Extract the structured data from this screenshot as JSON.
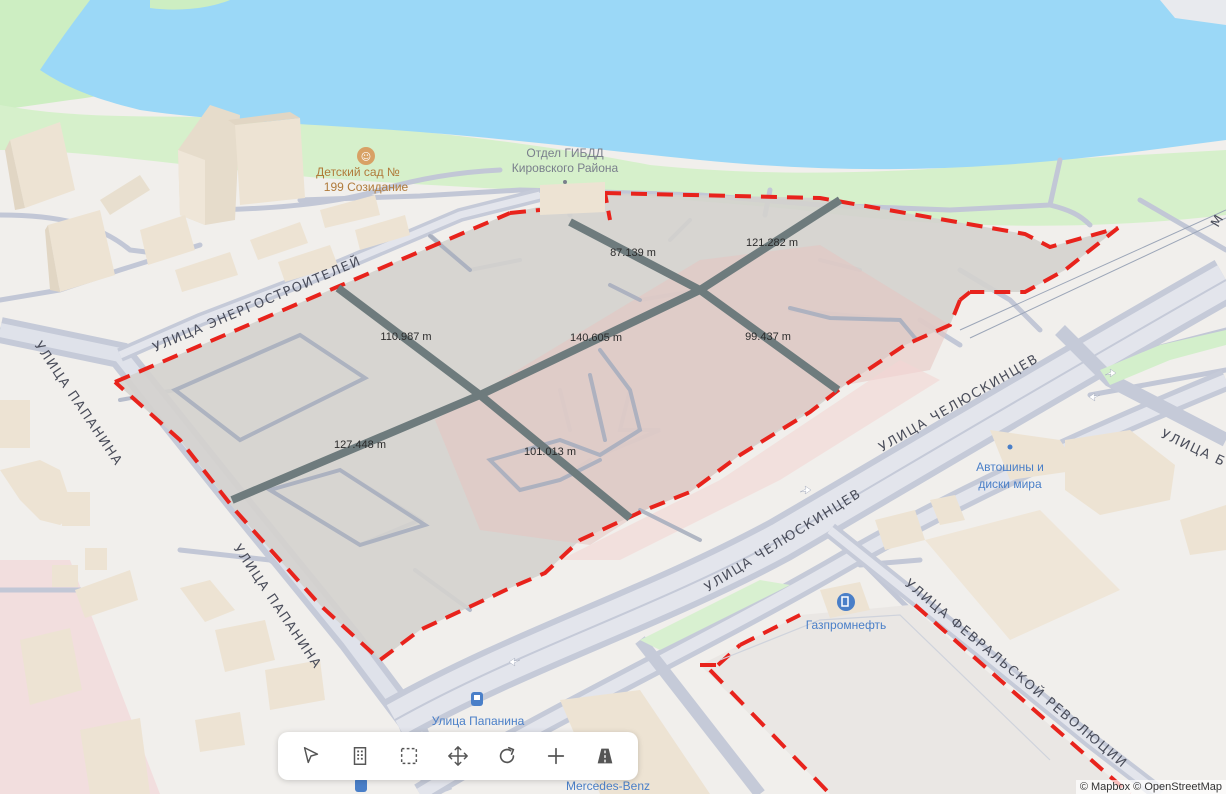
{
  "labels": {
    "streets": {
      "energostroiteley": "УЛИЦА ЭНЕРГОСТРОИТЕЛЕЙ",
      "papanina_upper": "УЛИЦА ПАПАНИНА",
      "papanina_lower": "УЛИЦА ПАПАНИНА",
      "chelyuskintsev_upper": "УЛИЦА ЧЕЛЮСКИНЦЕВ",
      "chelyuskintsev_lower": "УЛИЦА ЧЕЛЮСКИНЦЕВ",
      "fevralskoy": "УЛИЦА ФЕВРАЛЬСКОЙ РЕВОЛЮЦИИ",
      "edge_right": "УЛИЦА Б",
      "edge_topright": "М"
    },
    "pois": {
      "kindergarten_line1": "Детский сад №",
      "kindergarten_line2": "199 Созидание",
      "gibdd_line1": "Отдел ГИБДД",
      "gibdd_line2": "Кировского Района",
      "autoshiny_line1": "Автошины и",
      "autoshiny_line2": "диски мира",
      "gazprom": "Газпромнефть",
      "papanina_stop": "Улица Папанина",
      "mercedes": "Mercedes-Benz"
    },
    "measurements": [
      "87.139 m",
      "121.282 m",
      "110.987 m",
      "140.605 m",
      "99.437 m",
      "127.448 m",
      "101.013 m"
    ]
  },
  "toolbar": {
    "tools": [
      {
        "id": "select",
        "icon": "cursor-arrow-icon"
      },
      {
        "id": "building",
        "icon": "building-icon"
      },
      {
        "id": "area-select",
        "icon": "dashed-square-icon"
      },
      {
        "id": "move",
        "icon": "move-arrows-icon"
      },
      {
        "id": "rotate",
        "icon": "rotate-icon"
      },
      {
        "id": "add",
        "icon": "plus-icon"
      },
      {
        "id": "road",
        "icon": "road-icon"
      }
    ]
  },
  "attribution": "© Mapbox © OpenStreetMap",
  "colors": {
    "water": "#9bd8f7",
    "park": "#cdeec2",
    "land": "#f1efec",
    "building": "#ece2d2",
    "road": "#c2c7d6",
    "boundary": "#e8231c",
    "plot_grey": "#d4d1ce",
    "plot_pink": "#e9c8c6",
    "cut_line": "#6e7b7d"
  }
}
